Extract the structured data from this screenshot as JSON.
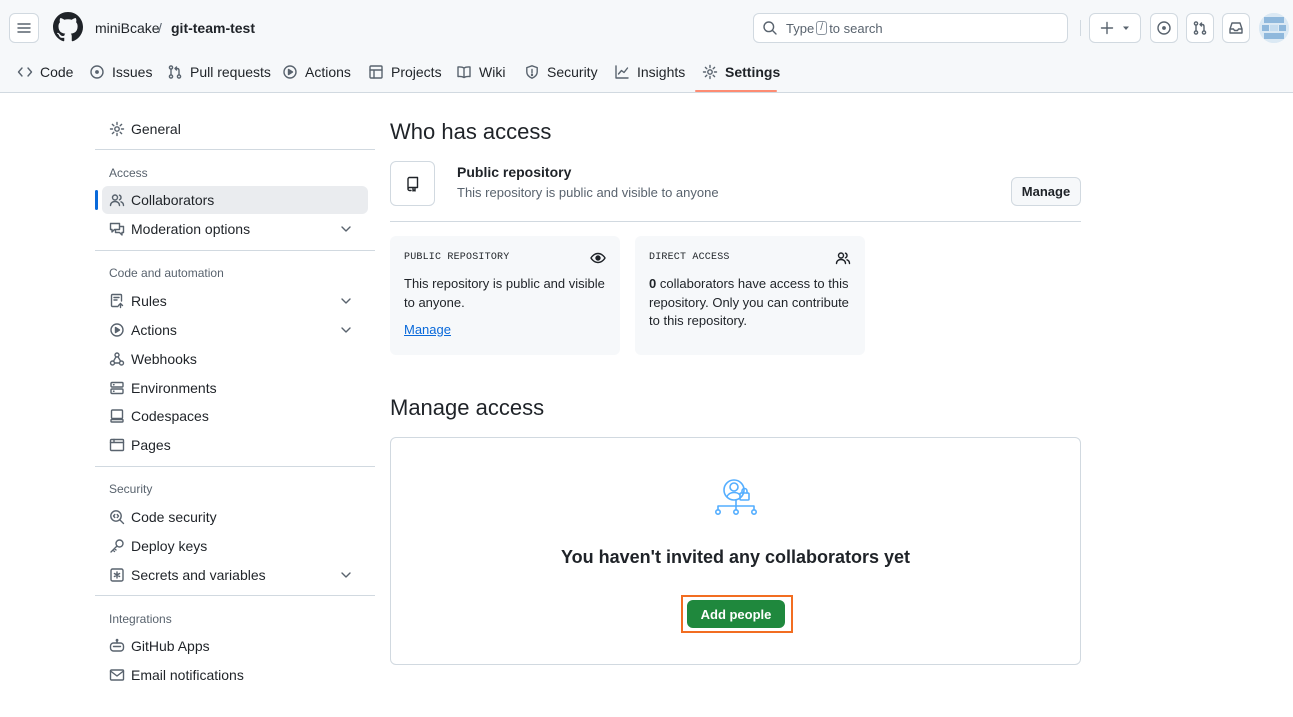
{
  "header": {
    "owner": "miniBcake",
    "separator": "/",
    "repo": "git-team-test",
    "search_prefix": "Type",
    "search_key": "/",
    "search_suffix": "to search",
    "icons": [
      "menu-icon",
      "github-logo",
      "search-icon",
      "plus-icon",
      "triangle-down-icon",
      "issue-opened-icon",
      "git-pull-request-icon",
      "inbox-icon",
      "avatar"
    ]
  },
  "repo_nav": {
    "tabs": [
      {
        "label": "Code",
        "icon": "code-icon"
      },
      {
        "label": "Issues",
        "icon": "issue-opened-icon"
      },
      {
        "label": "Pull requests",
        "icon": "git-pull-request-icon"
      },
      {
        "label": "Actions",
        "icon": "play-icon"
      },
      {
        "label": "Projects",
        "icon": "table-icon"
      },
      {
        "label": "Wiki",
        "icon": "book-icon"
      },
      {
        "label": "Security",
        "icon": "shield-icon"
      },
      {
        "label": "Insights",
        "icon": "graph-icon"
      },
      {
        "label": "Settings",
        "icon": "gear-icon"
      }
    ],
    "active_tab": "Settings"
  },
  "sidebar": {
    "general": "General",
    "access_heading": "Access",
    "access_items": [
      "Collaborators",
      "Moderation options"
    ],
    "code_heading": "Code and automation",
    "code_items": [
      "Rules",
      "Actions",
      "Webhooks",
      "Environments",
      "Codespaces",
      "Pages"
    ],
    "security_heading": "Security",
    "security_items": [
      "Code security",
      "Deploy keys",
      "Secrets and variables"
    ],
    "integrations_heading": "Integrations",
    "integrations_items": [
      "GitHub Apps",
      "Email notifications"
    ],
    "active_item": "Collaborators"
  },
  "main": {
    "who_title": "Who has access",
    "public_title": "Public repository",
    "public_desc": "This repository is public and visible to anyone",
    "manage_button": "Manage",
    "card_public": {
      "label": "PUBLIC REPOSITORY",
      "text": "This repository is public and visible to anyone.",
      "link": "Manage"
    },
    "card_direct": {
      "label": "DIRECT ACCESS",
      "count": "0",
      "text": "collaborators have access to this repository. Only you can contribute to this repository."
    },
    "manage_title": "Manage access",
    "empty_title": "You haven't invited any collaborators yet",
    "add_button": "Add people"
  },
  "colors": {
    "accent_blue": "#0969da",
    "primary_green": "#1f883d",
    "tab_underline": "#fd8c73",
    "highlight_orange": "#f26d21",
    "empty_icon_blue": "#54aeff"
  }
}
